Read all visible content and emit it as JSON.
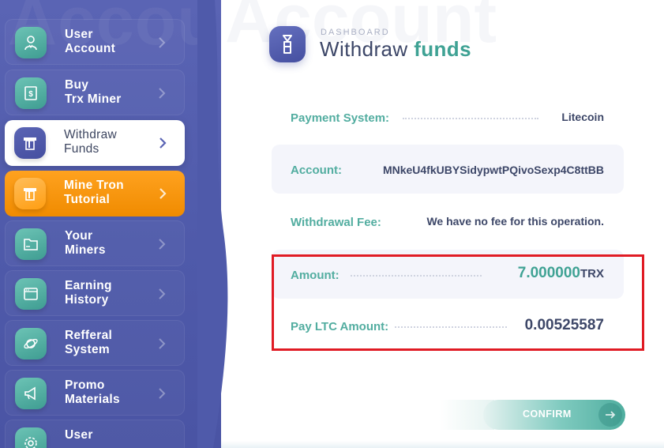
{
  "watermark": "Account",
  "sidebar": {
    "items": [
      {
        "label_line1": "User",
        "label_line2": "Account",
        "icon": "user-icon"
      },
      {
        "label_line1": "Buy",
        "label_line2": "Trx Miner",
        "icon": "receipt-dollar-icon"
      },
      {
        "label_line1": "Withdraw",
        "label_line2": "Funds",
        "icon": "atm-icon"
      },
      {
        "label_line1": "Mine Tron",
        "label_line2": "Tutorial",
        "icon": "atm-icon"
      },
      {
        "label_line1": "Your",
        "label_line2": "Miners",
        "icon": "folder-icon"
      },
      {
        "label_line1": "Earning",
        "label_line2": "History",
        "icon": "browser-window-icon"
      },
      {
        "label_line1": "Refferal",
        "label_line2": "System",
        "icon": "planet-icon"
      },
      {
        "label_line1": "Promo",
        "label_line2": "Materials",
        "icon": "megaphone-icon"
      },
      {
        "label_line1": "User",
        "label_line2": "",
        "icon": "settings-icon"
      }
    ],
    "active_index": 2,
    "highlight_index": 3
  },
  "header": {
    "breadcrumb": "DASHBOARD",
    "title_main": "Withdraw",
    "title_accent": "funds",
    "icon": "tron-logo-icon"
  },
  "form": {
    "payment_system": {
      "label": "Payment System:",
      "value": "Litecoin"
    },
    "account": {
      "label": "Account:",
      "value": "MNkeU4fkUBYSidypwtPQivoSexp4C8ttBB"
    },
    "withdrawal_fee": {
      "label": "Withdrawal Fee:",
      "value": "We have no fee for this operation."
    },
    "amount": {
      "label": "Amount:",
      "value": "7.000000",
      "unit": "TRX"
    },
    "pay_amount": {
      "label": "Pay LTC Amount:",
      "value": "0.00525587"
    }
  },
  "confirm_button": {
    "label": "CONFIRM",
    "icon": "arrow-right-icon"
  },
  "colors": {
    "sidebar": "#525cae",
    "accent_teal": "#3fa294",
    "orange": "#ff9a12",
    "highlight_red": "#e01b24",
    "text_dark": "#3d4768"
  }
}
